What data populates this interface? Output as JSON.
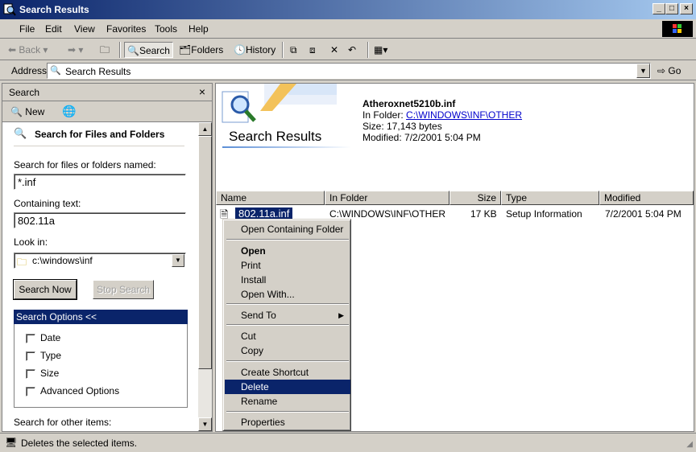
{
  "window": {
    "title": "Search Results",
    "min": "_",
    "max": "□",
    "close": "×"
  },
  "menu": [
    "File",
    "Edit",
    "View",
    "Favorites",
    "Tools",
    "Help"
  ],
  "toolbar": {
    "back": "Back",
    "search": "Search",
    "folders": "Folders",
    "history": "History"
  },
  "address": {
    "label": "Address",
    "value": "Search Results",
    "go": "Go"
  },
  "search_pane": {
    "title": "Search",
    "new": "New",
    "heading": "Search for Files and Folders",
    "name_label": "Search for files or folders named:",
    "name_value": "*.inf",
    "text_label": "Containing text:",
    "text_value": "802.11a",
    "lookin_label": "Look in:",
    "lookin_value": "c:\\windows\\inf",
    "search_now": "Search Now",
    "stop_search": "Stop Search",
    "options_header": "Search Options <<",
    "options": [
      "Date",
      "Type",
      "Size",
      "Advanced Options"
    ],
    "other_items": "Search for other items:"
  },
  "results": {
    "banner_title": "Search Results",
    "info": {
      "file_name": "Atheroxnet5210b.inf",
      "folder_prefix": "In Folder: ",
      "folder": "C:\\WINDOWS\\INF\\OTHER",
      "size": "Size: 17,143 bytes",
      "modified": "Modified: 7/2/2001 5:04 PM"
    },
    "columns": [
      "Name",
      "In Folder",
      "Size",
      "Type",
      "Modified"
    ],
    "row": {
      "name": "802.11a.inf",
      "folder": "C:\\WINDOWS\\INF\\OTHER",
      "size": "17 KB",
      "type": "Setup Information",
      "modified": "7/2/2001 5:04 PM"
    }
  },
  "context_menu": {
    "open_folder": "Open Containing Folder",
    "open": "Open",
    "print": "Print",
    "install": "Install",
    "open_with": "Open With...",
    "send_to": "Send To",
    "cut": "Cut",
    "copy": "Copy",
    "create_shortcut": "Create Shortcut",
    "delete": "Delete",
    "rename": "Rename",
    "properties": "Properties"
  },
  "status": {
    "text": "Deletes the selected items."
  },
  "colors": {
    "titlebar": "#0a246a",
    "selection": "#0a246a",
    "face": "#d4d0c8"
  }
}
